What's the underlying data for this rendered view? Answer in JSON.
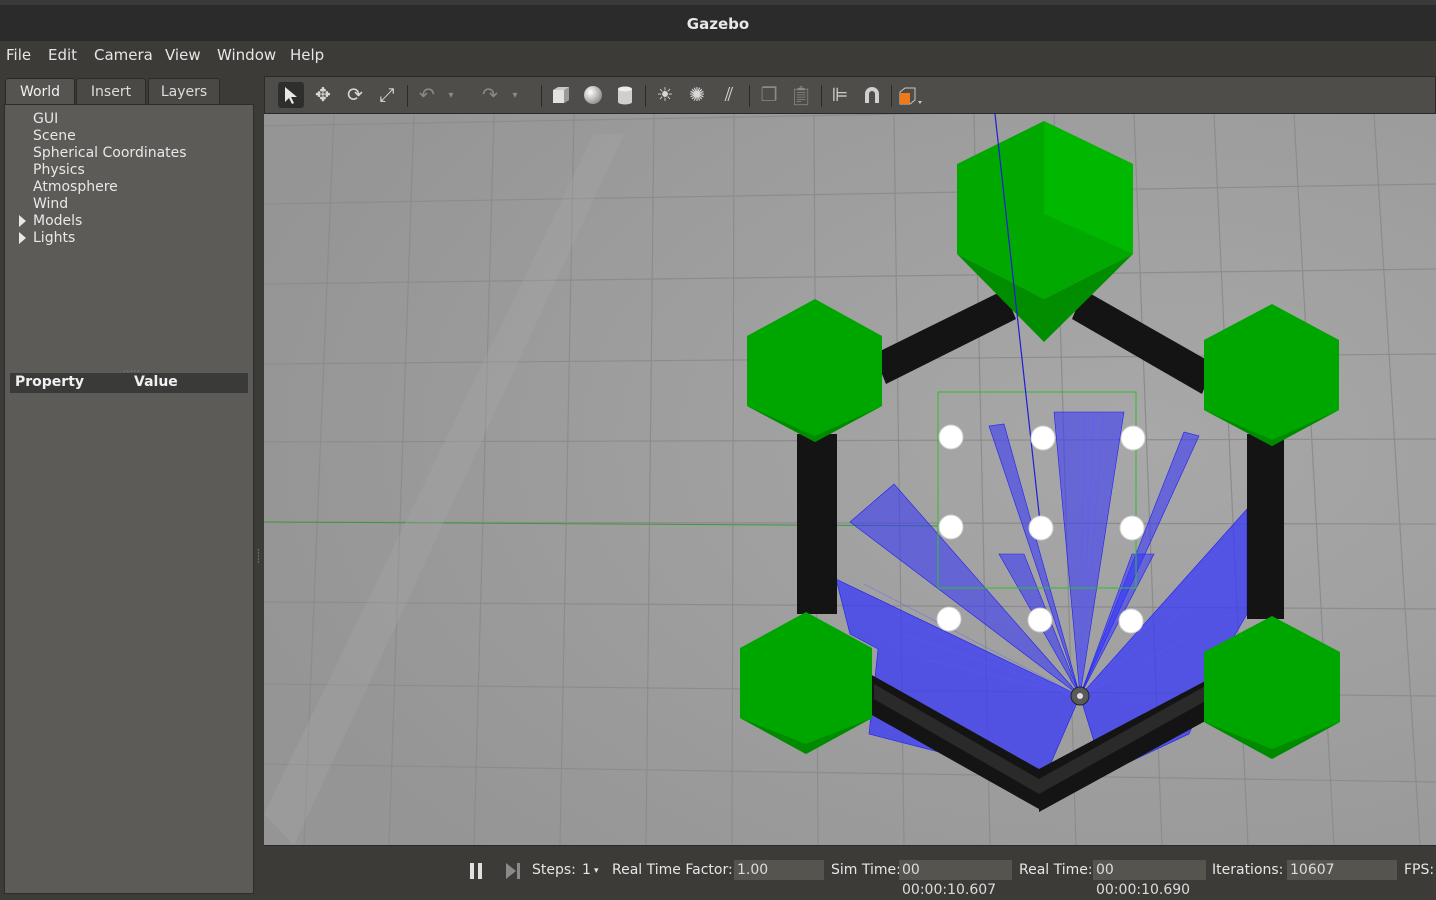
{
  "window": {
    "title": "Gazebo"
  },
  "menu": {
    "file": "File",
    "edit": "Edit",
    "camera": "Camera",
    "view": "View",
    "window": "Window",
    "help": "Help"
  },
  "tabs": {
    "world": "World",
    "insert": "Insert",
    "layers": "Layers"
  },
  "tree": {
    "items": [
      "GUI",
      "Scene",
      "Spherical Coordinates",
      "Physics",
      "Atmosphere",
      "Wind",
      "Models",
      "Lights"
    ]
  },
  "properties": {
    "col_property": "Property",
    "col_value": "Value"
  },
  "toolbar": {
    "icons": [
      "select-arrow-icon",
      "translate-icon",
      "rotate-icon",
      "scale-icon",
      "undo-icon",
      "redo-icon",
      "box-icon",
      "sphere-icon",
      "cylinder-icon",
      "point-light-icon",
      "spot-light-icon",
      "directional-light-icon",
      "copy-icon",
      "paste-icon",
      "align-icon",
      "snap-magnet-icon",
      "view-angle-icon"
    ],
    "accent": "#f07a1a"
  },
  "status": {
    "steps_label": "Steps:",
    "steps_value": "1",
    "rtf_label": "Real Time Factor:",
    "rtf_value": "1.00",
    "sim_label": "Sim Time:",
    "sim_value": "00 00:00:10.607",
    "real_label": "Real Time:",
    "real_value": "00 00:00:10.690",
    "iter_label": "Iterations:",
    "iter_value": "10607",
    "fps_label": "FPS:"
  },
  "scene": {
    "colors": {
      "ground": "#9d9d9d",
      "grid": "#8a8a8a",
      "wall": "#151515",
      "pillar": "#00a800",
      "laser": "#3232ff",
      "obstacle": "#ffffff"
    }
  }
}
